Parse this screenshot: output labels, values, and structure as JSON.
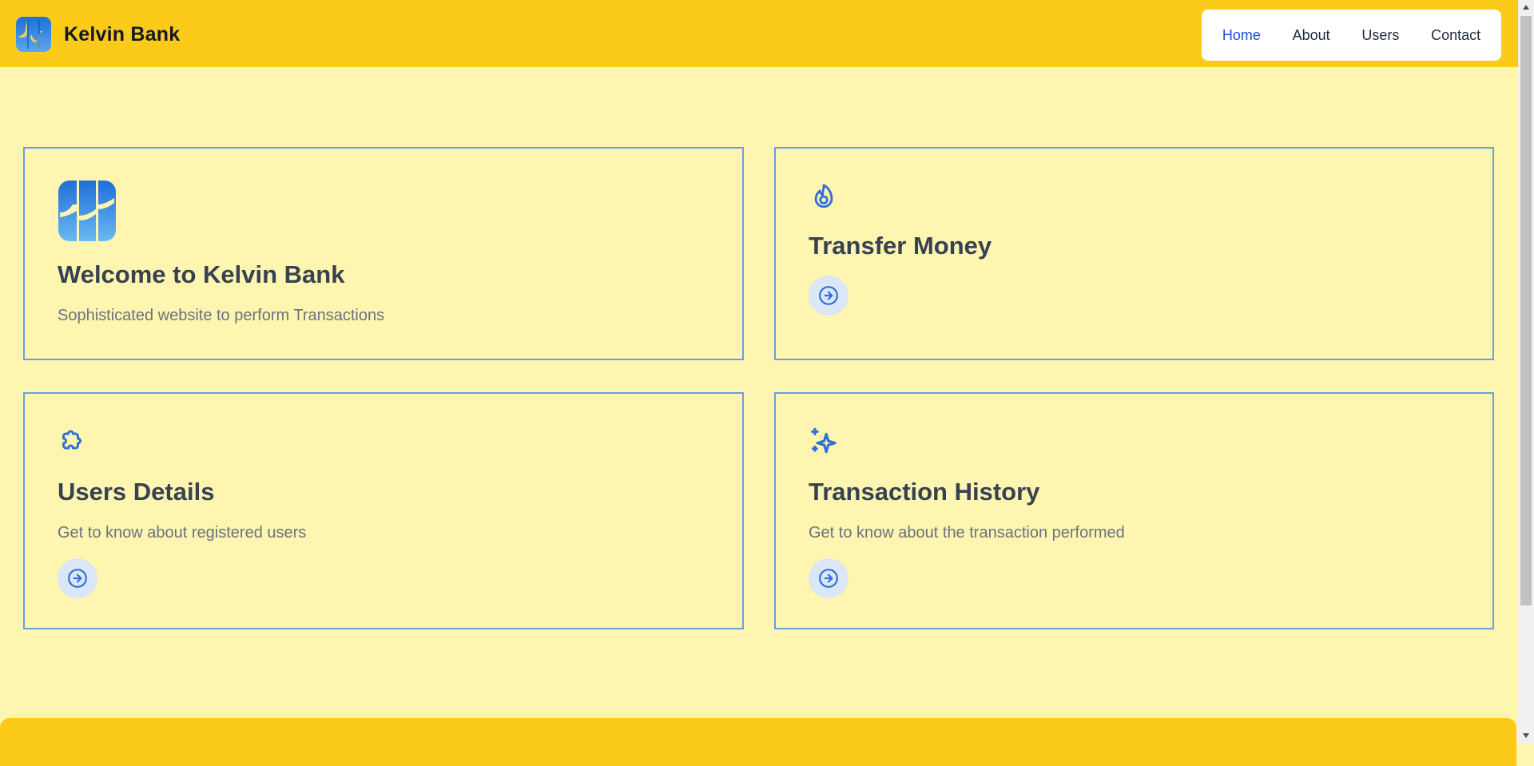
{
  "header": {
    "brand_name": "Kelvin Bank",
    "nav": [
      {
        "label": "Home",
        "active": true
      },
      {
        "label": "About"
      },
      {
        "label": "Users"
      },
      {
        "label": "Contact"
      }
    ]
  },
  "cards": {
    "welcome": {
      "title": "Welcome to Kelvin Bank",
      "description": "Sophisticated website to perform Transactions",
      "icon": "bank-logo-icon"
    },
    "transfer": {
      "title": "Transfer Money",
      "icon": "flame-icon"
    },
    "users": {
      "title": "Users Details",
      "description": "Get to know about registered users",
      "icon": "puzzle-icon"
    },
    "history": {
      "title": "Transaction History",
      "description": "Get to know about the transaction performed",
      "icon": "sparkles-icon"
    }
  },
  "colors": {
    "header_bg": "#fccb19",
    "page_bg": "#fdf5b0",
    "card_border": "#6b9ee8",
    "accent_blue": "#2f6fd9",
    "nav_active": "#1d4ed8"
  }
}
